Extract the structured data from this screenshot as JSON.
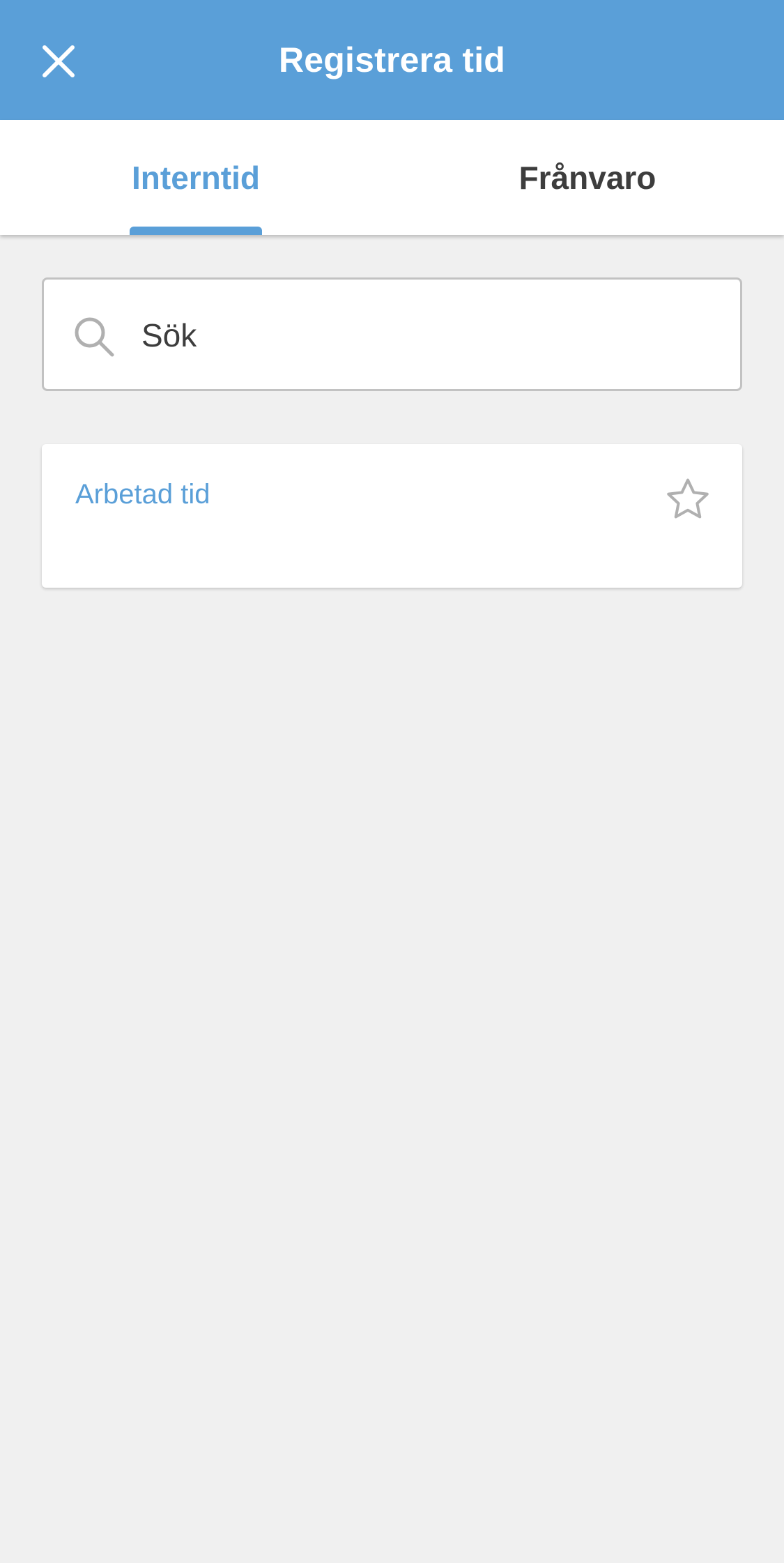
{
  "header": {
    "title": "Registrera tid",
    "close_icon": "close-icon",
    "background_color": "#5a9fd8"
  },
  "tabs": [
    {
      "label": "Interntid",
      "selected": true
    },
    {
      "label": "Frånvaro",
      "selected": false
    }
  ],
  "search": {
    "placeholder": "Sök",
    "value": "",
    "icon": "search-icon"
  },
  "items": [
    {
      "label": "Arbetad tid",
      "favorite": false,
      "icon": "star-outline-icon"
    }
  ],
  "colors": {
    "accent": "#5a9fd8",
    "text_dark": "#3d3d3d",
    "background": "#f0f0f0",
    "icon_gray": "#b0b0b0"
  }
}
